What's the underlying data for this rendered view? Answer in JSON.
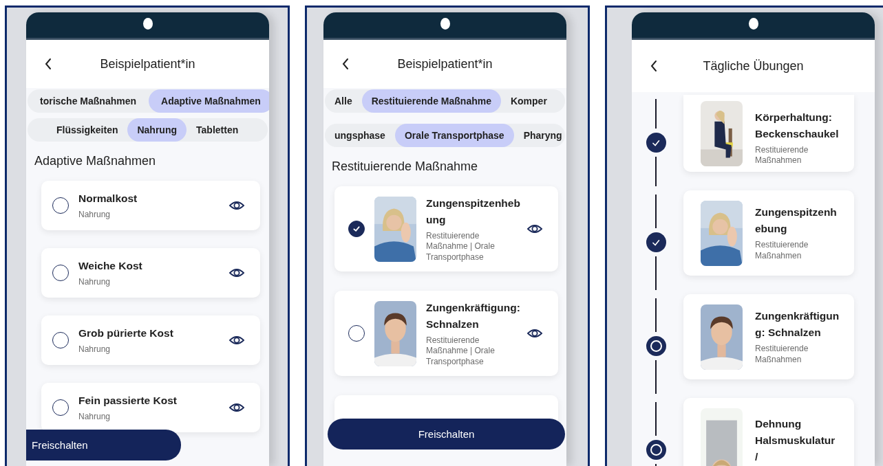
{
  "screens": [
    {
      "kind": "selection",
      "title": "Beispielpatient*in",
      "chip_rows": [
        [
          {
            "label": "torische Maßnahmen",
            "selected": false
          },
          {
            "label": "Adaptive Maßnahmen",
            "selected": true
          }
        ],
        [
          {
            "label": "Flüssigkeiten",
            "selected": false
          },
          {
            "label": "Nahrung",
            "selected": true
          },
          {
            "label": "Tabletten",
            "selected": false
          }
        ]
      ],
      "section_title": "Adaptive Maßnahmen",
      "items": [
        {
          "title": "Normalkost",
          "subtitle": "Nahrung",
          "checked": false
        },
        {
          "title": "Weiche Kost",
          "subtitle": "Nahrung",
          "checked": false
        },
        {
          "title": "Grob pürierte Kost",
          "subtitle": "Nahrung",
          "checked": false
        },
        {
          "title": "Fein passierte Kost",
          "subtitle": "Nahrung",
          "checked": false
        }
      ],
      "button": {
        "label": "Freischalten",
        "kind": "docked"
      }
    },
    {
      "kind": "selection",
      "title": "Beispielpatient*in",
      "chip_rows": [
        [
          {
            "label": "Alle",
            "selected": false
          },
          {
            "label": "Restituierende Maßnahme",
            "selected": true
          },
          {
            "label": "Komper",
            "selected": false
          }
        ],
        [
          {
            "label": "ungsphase",
            "selected": false
          },
          {
            "label": "Orale Transportphase",
            "selected": true
          },
          {
            "label": "Pharyng",
            "selected": false
          }
        ]
      ],
      "section_title": "Restituierende Maßnahme",
      "items": [
        {
          "title": "Zungenspitzenhebung",
          "subtitle": "Restituierende Maßnahme | Orale Transportphase",
          "checked": true
        },
        {
          "title": "Zungenkräftigung: Schnalzen",
          "subtitle": "Restituierende Maßnahme | Orale Transportphase",
          "checked": false
        }
      ],
      "button": {
        "label": "Freischalten",
        "kind": "full"
      }
    },
    {
      "kind": "timeline",
      "title": "Tägliche Übungen",
      "items": [
        {
          "title": "Körperhaltung: Beckenschaukel",
          "subtitle": "Restituierende Maßnahmen",
          "done": true
        },
        {
          "title": "Zungenspitzenhebung",
          "subtitle": "Restituierende Maßnahmen",
          "done": true
        },
        {
          "title": "Zungenkräftigung: Schnalzen",
          "subtitle": "Restituierende Maßnahmen",
          "done": false
        },
        {
          "title": "Dehnung Halsmuskulatur /",
          "done": false
        }
      ]
    }
  ]
}
